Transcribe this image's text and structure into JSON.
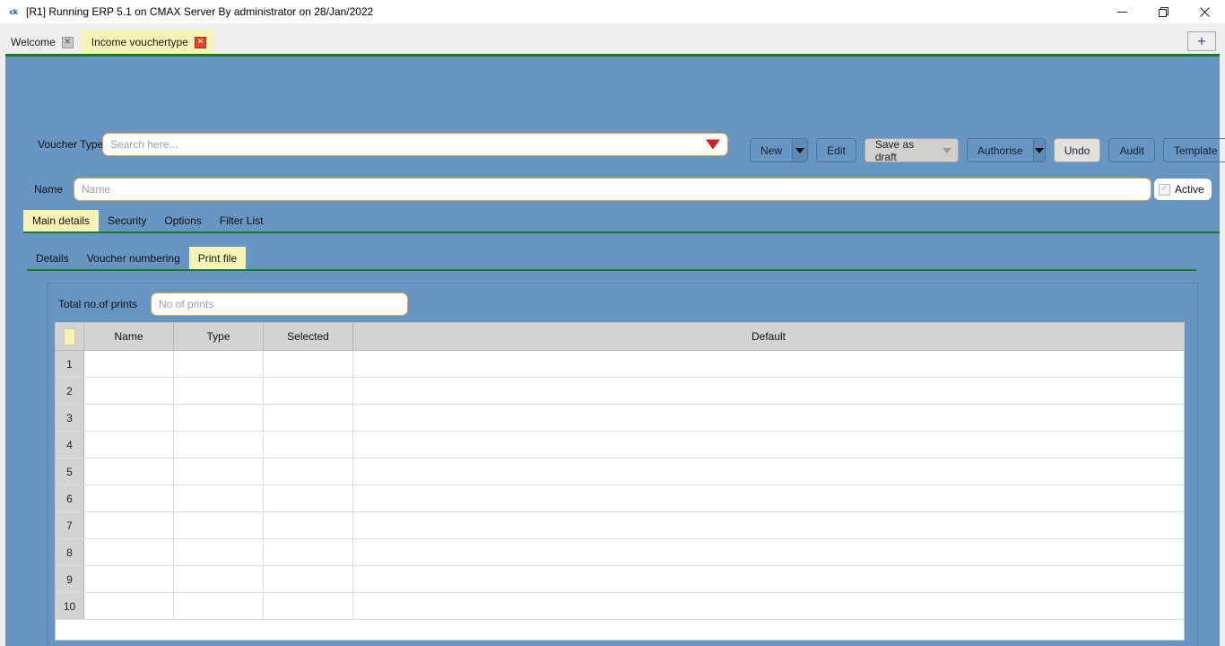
{
  "window": {
    "title": "[R1] Running ERP 5.1 on CMAX Server By administrator on 28/Jan/2022",
    "app_icon": "ck",
    "minimize_label": "–",
    "maximize_label": "❐",
    "close_label": "✕"
  },
  "doc_tabs": {
    "items": [
      {
        "label": "Welcome",
        "close": "✕",
        "active": false
      },
      {
        "label": "Income vouchertype",
        "close": "✕",
        "active": true
      }
    ],
    "add_tab_label": "+"
  },
  "form": {
    "voucher_type_label": "Voucher Type",
    "voucher_type_placeholder": "Search here...",
    "voucher_type_value": "",
    "name_label": "Name",
    "name_placeholder": "Name",
    "name_value": "",
    "active_label": "Active",
    "active_checked": true,
    "active_mark": "✓"
  },
  "toolbar": {
    "new_label": "New",
    "edit_label": "Edit",
    "save_as_draft_label": "Save as draft",
    "authorise_label": "Authorise",
    "undo_label": "Undo",
    "audit_label": "Audit",
    "template_label": "Template"
  },
  "tabs_primary": [
    {
      "label": "Main details",
      "active": true
    },
    {
      "label": "Security",
      "active": false
    },
    {
      "label": "Options",
      "active": false
    },
    {
      "label": "Filter List",
      "active": false
    }
  ],
  "tabs_secondary": [
    {
      "label": "Details",
      "active": false
    },
    {
      "label": "Voucher numbering",
      "active": false
    },
    {
      "label": "Print file",
      "active": true
    }
  ],
  "print_file": {
    "total_prints_label": "Total no.of prints",
    "total_prints_placeholder": "No of prints",
    "total_prints_value": "",
    "grid": {
      "columns": [
        "",
        "Name",
        "Type",
        "Selected",
        "Default"
      ],
      "rows": [
        {
          "num": "1",
          "name": "",
          "type": "",
          "selected": "",
          "default": ""
        },
        {
          "num": "2",
          "name": "",
          "type": "",
          "selected": "",
          "default": ""
        },
        {
          "num": "3",
          "name": "",
          "type": "",
          "selected": "",
          "default": ""
        },
        {
          "num": "4",
          "name": "",
          "type": "",
          "selected": "",
          "default": ""
        },
        {
          "num": "5",
          "name": "",
          "type": "",
          "selected": "",
          "default": ""
        },
        {
          "num": "6",
          "name": "",
          "type": "",
          "selected": "",
          "default": ""
        },
        {
          "num": "7",
          "name": "",
          "type": "",
          "selected": "",
          "default": ""
        },
        {
          "num": "8",
          "name": "",
          "type": "",
          "selected": "",
          "default": ""
        },
        {
          "num": "9",
          "name": "",
          "type": "",
          "selected": "",
          "default": ""
        },
        {
          "num": "10",
          "name": "",
          "type": "",
          "selected": "",
          "default": ""
        }
      ]
    }
  },
  "colors": {
    "panel_blue": "#6795c4",
    "accent_green": "#1e7a1e",
    "tab_yellow": "#f7f5b5",
    "field_border_orange": "#e8a33d",
    "dropdown_red": "#d11f1f"
  }
}
